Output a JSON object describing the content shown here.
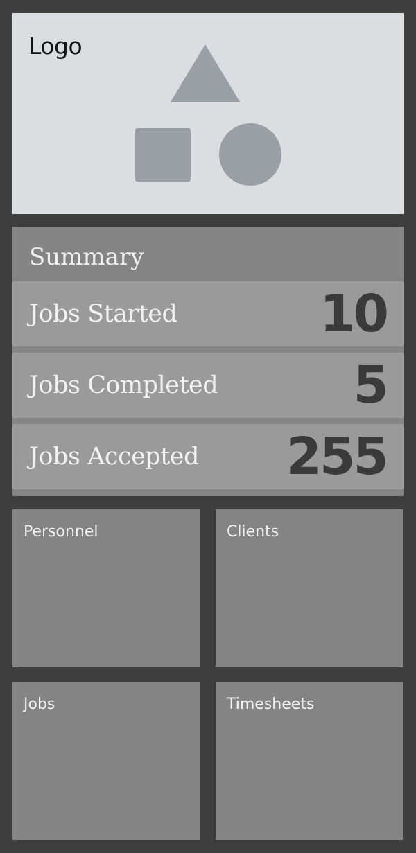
{
  "logo": {
    "label": "Logo",
    "shape_color": "#9a9fa6"
  },
  "summary": {
    "title": "Summary",
    "stats": [
      {
        "label": "Jobs Started",
        "value": "10"
      },
      {
        "label": "Jobs Completed",
        "value": "5"
      },
      {
        "label": "Jobs Accepted",
        "value": "255"
      }
    ]
  },
  "tiles": [
    {
      "label": "Personnel"
    },
    {
      "label": "Clients"
    },
    {
      "label": "Jobs"
    },
    {
      "label": "Timesheets"
    }
  ],
  "colors": {
    "background": "#3e3e3e",
    "logo_panel": "#dcdde0",
    "summary_header": "#848484",
    "stat_row": "#9a9a9a",
    "tile": "#848484",
    "value_text": "#3a3a3a"
  }
}
